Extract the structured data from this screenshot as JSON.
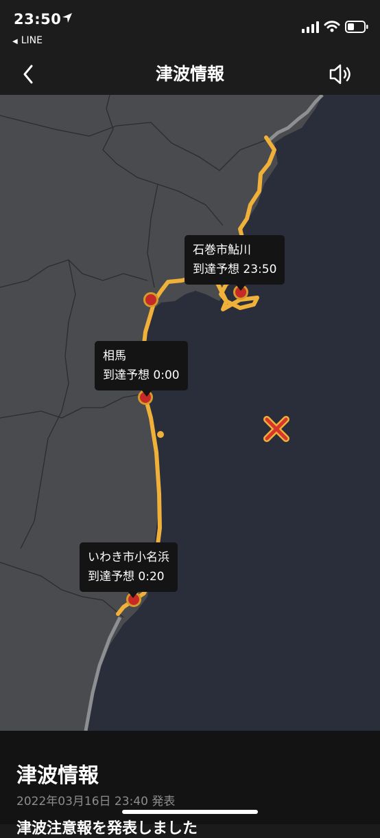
{
  "status": {
    "time": "23:50",
    "back_app": "LINE",
    "icons": [
      "location-arrow-icon",
      "signal-bars-icon",
      "wifi-icon",
      "battery-icon"
    ]
  },
  "nav": {
    "back_icon": "chevron-left-icon",
    "title": "津波情報",
    "sound_icon": "speaker-icon"
  },
  "map": {
    "markers": [
      {
        "name": "石巻市鮎川",
        "arrival": "到達予想 23:50"
      },
      {
        "name": "相馬",
        "arrival": "到達予想 0:00"
      },
      {
        "name": "いわき市小名浜",
        "arrival": "到達予想 0:20"
      }
    ],
    "epicenter_icon": "epicenter-x-icon",
    "colors": {
      "sea": "#2a2d3a",
      "land": "#4a4b4e",
      "warning_coast": "#f0b13a",
      "pin": "#c62a26"
    }
  },
  "sheet": {
    "title": "津波情報",
    "date": "2022年03月16日 23:40 発表",
    "body": "津波注意報を発表しました"
  }
}
